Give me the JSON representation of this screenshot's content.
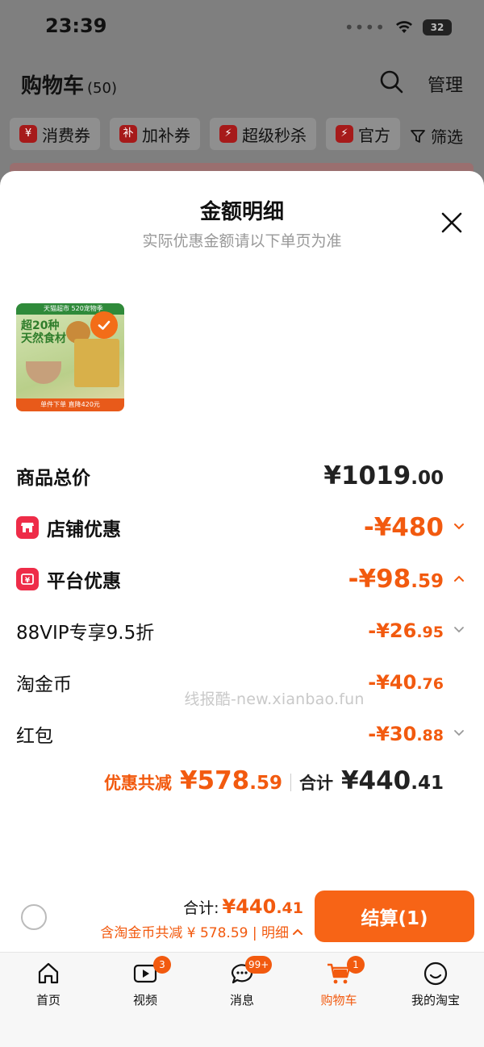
{
  "status_bar": {
    "time": "23:39",
    "battery": "32"
  },
  "page": {
    "title": "购物车",
    "count": "(50)",
    "manage": "管理"
  },
  "chips": [
    {
      "icon": "¥",
      "label": "消费券"
    },
    {
      "icon": "补",
      "label": "加补券"
    },
    {
      "icon": "⚡",
      "label": "超级秒杀"
    },
    {
      "icon": "⚡",
      "label": "官方"
    }
  ],
  "filter_label": "筛选",
  "sheet": {
    "title": "金额明细",
    "subtitle": "实际优惠金额请以下单页为准",
    "product": {
      "band": "天猫超市 520宠物季",
      "headline1": "超20种",
      "headline2": "天然食材",
      "footer": "单件下单 直降420元"
    },
    "rows": {
      "total": {
        "label": "商品总价",
        "int": "¥1019",
        "dec": ".00"
      },
      "shop": {
        "label": "店铺优惠",
        "int": "-¥480",
        "dec": ""
      },
      "platform": {
        "label": "平台优惠",
        "int": "-¥98",
        "dec": ".59"
      },
      "vip": {
        "label": "88VIP专享9.5折",
        "int": "-¥26",
        "dec": ".95"
      },
      "coin": {
        "label": "淘金币",
        "int": "-¥40",
        "dec": ".76"
      },
      "redpack": {
        "label": "红包",
        "int": "-¥30",
        "dec": ".88"
      }
    },
    "watermark": "线报酷-new.xianbao.fun",
    "summary": {
      "discount_label": "优惠共减",
      "discount_int": "¥578",
      "discount_dec": ".59",
      "total_label": "合计",
      "total_int": "¥440",
      "total_dec": ".41"
    }
  },
  "checkout": {
    "total_label": "合计:",
    "total_int": "¥440",
    "total_dec": ".41",
    "sub": "含淘金币共减 ¥ 578.59 | 明细",
    "button": "结算(1)"
  },
  "tabs": [
    {
      "label": "首页",
      "badge": ""
    },
    {
      "label": "视频",
      "badge": "3"
    },
    {
      "label": "消息",
      "badge": "99+"
    },
    {
      "label": "购物车",
      "badge": "1"
    },
    {
      "label": "我的淘宝",
      "badge": ""
    }
  ],
  "colors": {
    "accent": "#f25a0f",
    "shop_icon": "#ee2c48",
    "button": "#f76416"
  }
}
